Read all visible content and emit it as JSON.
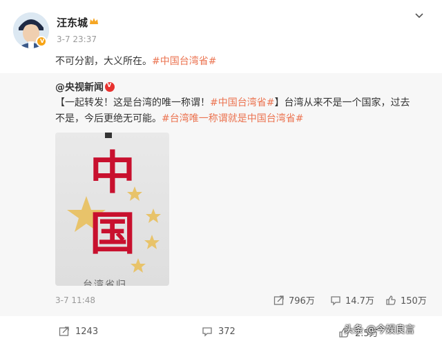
{
  "post": {
    "author": "汪东城",
    "time": "3-7 23:37",
    "text_prefix": "不可分割，大义所在。",
    "hashtag": "#中国台湾省#"
  },
  "repost": {
    "author": "@央视新闻",
    "text_part1": "【一起转发！这是台湾的唯一称谓！",
    "hashtag1": "#中国台湾省#",
    "text_part2": "】台湾从来不是一个国家，过去不是，今后更绝无可能。",
    "hashtag2": "#台湾唯一称谓就是中国台湾省#",
    "image": {
      "big_text": "中国",
      "bottom_text": "台湾省归"
    },
    "time": "3-7 11:48",
    "stats": {
      "reposts": "796万",
      "comments": "14.7万",
      "likes": "150万"
    }
  },
  "bottom_stats": {
    "reposts": "1243",
    "comments": "372",
    "likes": "2.5万"
  },
  "watermark": "头条 @今娱良言",
  "colors": {
    "hashtag": "#eb7350",
    "gold_badge": "#f7a415",
    "red": "#c8102e"
  }
}
